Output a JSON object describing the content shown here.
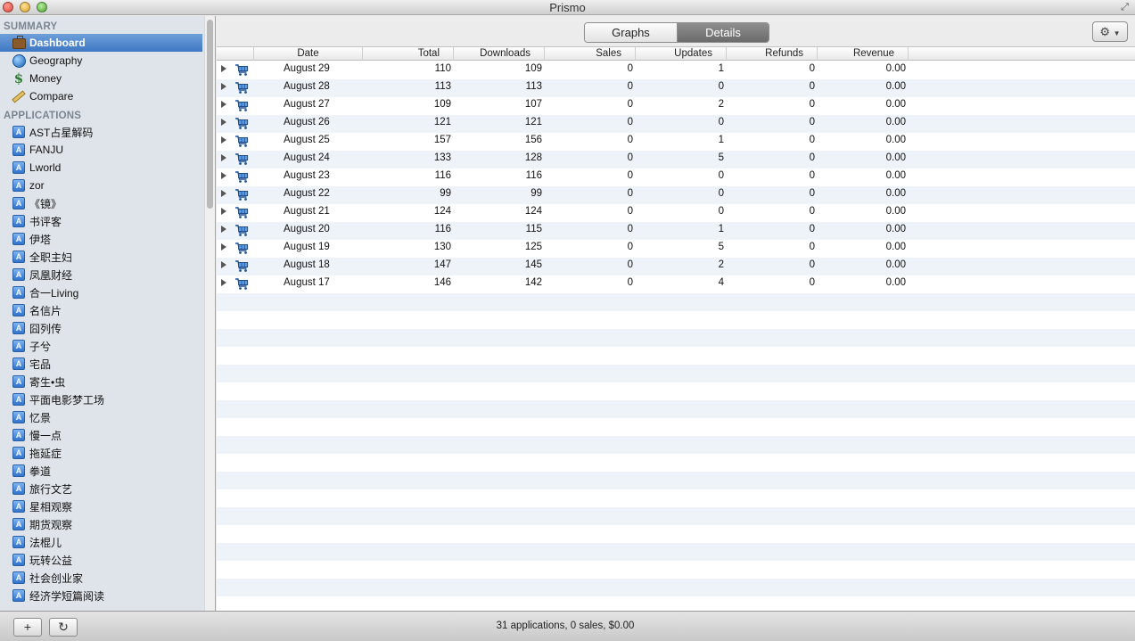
{
  "window": {
    "title": "Prismo"
  },
  "sidebar": {
    "summary_header": "SUMMARY",
    "summary_items": [
      {
        "label": "Dashboard",
        "icon": "briefcase-icon",
        "selected": true
      },
      {
        "label": "Geography",
        "icon": "globe-icon"
      },
      {
        "label": "Money",
        "icon": "dollar-icon"
      },
      {
        "label": "Compare",
        "icon": "ruler-icon"
      }
    ],
    "apps_header": "APPLICATIONS",
    "apps": [
      "AST占星解码",
      "FANJU",
      "Lworld",
      "zor",
      "《镜》",
      "书评客",
      "伊塔",
      "全职主妇",
      "凤凰财经",
      "合一Living",
      "名信片",
      "囧列传",
      "子兮",
      "宅品",
      "寄生•虫",
      "平面电影梦工场",
      "忆景",
      "慢一点",
      "拖延症",
      "拳道",
      "旅行文艺",
      "星相观察",
      "期货观察",
      "法棍儿",
      "玩转公益",
      "社会创业家",
      "经济学短篇阅读"
    ]
  },
  "toolbar": {
    "tabs": [
      {
        "label": "Graphs",
        "active": false
      },
      {
        "label": "Details",
        "active": true
      }
    ],
    "settings_icon": "gear-icon"
  },
  "table": {
    "columns": [
      "Date",
      "Total",
      "Downloads",
      "Sales",
      "Updates",
      "Refunds",
      "Revenue"
    ],
    "rows": [
      [
        "August 29",
        "110",
        "109",
        "0",
        "1",
        "0",
        "0.00"
      ],
      [
        "August 28",
        "113",
        "113",
        "0",
        "0",
        "0",
        "0.00"
      ],
      [
        "August 27",
        "109",
        "107",
        "0",
        "2",
        "0",
        "0.00"
      ],
      [
        "August 26",
        "121",
        "121",
        "0",
        "0",
        "0",
        "0.00"
      ],
      [
        "August 25",
        "157",
        "156",
        "0",
        "1",
        "0",
        "0.00"
      ],
      [
        "August 24",
        "133",
        "128",
        "0",
        "5",
        "0",
        "0.00"
      ],
      [
        "August 23",
        "116",
        "116",
        "0",
        "0",
        "0",
        "0.00"
      ],
      [
        "August 22",
        "99",
        "99",
        "0",
        "0",
        "0",
        "0.00"
      ],
      [
        "August 21",
        "124",
        "124",
        "0",
        "0",
        "0",
        "0.00"
      ],
      [
        "August 20",
        "116",
        "115",
        "0",
        "1",
        "0",
        "0.00"
      ],
      [
        "August 19",
        "130",
        "125",
        "0",
        "5",
        "0",
        "0.00"
      ],
      [
        "August 18",
        "147",
        "145",
        "0",
        "2",
        "0",
        "0.00"
      ],
      [
        "August 17",
        "146",
        "142",
        "0",
        "4",
        "0",
        "0.00"
      ]
    ]
  },
  "bottombar": {
    "add_label": "+",
    "refresh_label": "↻",
    "status": "31 applications, 0 sales, $0.00"
  },
  "colors": {
    "selection": "#3e77c3",
    "stripe": "#eef3fa",
    "sidebar_bg": "#dfe4ea"
  }
}
